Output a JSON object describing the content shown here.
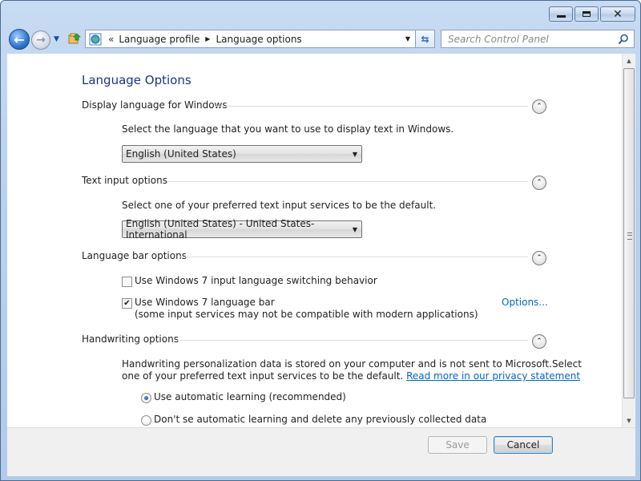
{
  "window": {
    "controls": {
      "minimize": "minimize-icon",
      "maximize": "maximize-icon",
      "close": "close-icon"
    }
  },
  "nav": {
    "back_icon": "back-arrow-icon",
    "forward_icon": "forward-arrow-icon",
    "breadcrumb": [
      "Language profile",
      "Language options"
    ],
    "search_placeholder": "Search Control Panel"
  },
  "page": {
    "title": "Language Options",
    "display_language": {
      "heading": "Display language for Windows",
      "description": "Select the language that you want to use to display text in Windows.",
      "selected": "English (United States)"
    },
    "text_input": {
      "heading": "Text input options",
      "description": "Select one of your preferred text input services to be the default.",
      "selected": "English (United States) - United States-International"
    },
    "language_bar": {
      "heading": "Language bar options",
      "switching_label": "Use Windows 7 input language switching behavior",
      "switching_checked": false,
      "langbar_label": "Use Windows 7 language bar",
      "langbar_note": "(some input services may not be compatible with modern applications)",
      "langbar_checked": true,
      "options_link": "Options..."
    },
    "handwriting": {
      "heading": "Handwriting options",
      "description_line1": "Handwriting personalization data is stored on your computer and is not sent to Microsoft.Select",
      "description_line2": "one of your preferred text input services to be the default. ",
      "privacy_link": "Read more in our privacy statement",
      "radio_auto": "Use automatic learning (recommended)",
      "radio_noauto": "Don't se automatic learning and delete any previously collected data",
      "selected": "auto"
    }
  },
  "footer": {
    "save": "Save",
    "cancel": "Cancel"
  },
  "colors": {
    "title": "#1e3287",
    "link": "#0066cc"
  }
}
